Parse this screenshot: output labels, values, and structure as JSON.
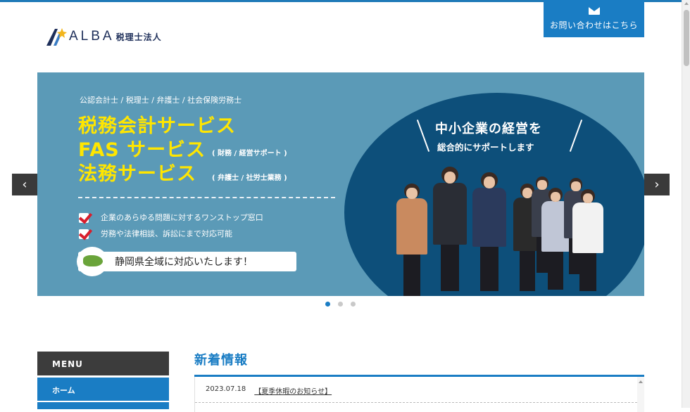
{
  "header": {
    "logo_text": "ALBA",
    "logo_sub": "税理士法人",
    "contact_label": "お問い合わせはこちら",
    "contact_icon": "mail-icon"
  },
  "slider": {
    "qualifications": "公認会計士 / 税理士 / 弁護士 / 社会保険労務士",
    "line1": "税務会計サービス",
    "line2": "FAS サービス",
    "line2_sub": "( 財務 / 経営サポート )",
    "line3": "法務サービス",
    "line3_sub": "( 弁護士 / 社労士業務 )",
    "check1": "企業のあらゆる問題に対するワンストップ窓口",
    "check2": "労務や法律相談、訴訟にまで対応可能",
    "region": "静岡県全域に対応いたします！",
    "circle_title": "中小企業の経営を",
    "circle_sub": "総合的にサポートします",
    "prev_label": "‹",
    "next_label": "›",
    "dots_count": 3,
    "active_dot": 1
  },
  "menu": {
    "title": "MENU",
    "items": [
      {
        "label": "ホーム"
      }
    ]
  },
  "news": {
    "title": "新着情報",
    "items": [
      {
        "date": "2023.07.18",
        "title": "【夏季休暇のお知らせ】"
      }
    ]
  },
  "colors": {
    "brand_blue": "#1a7dc4",
    "slider_bg": "#5b9ab7",
    "circle_bg": "#0d4f7a",
    "headline_yellow": "#ffe600"
  }
}
